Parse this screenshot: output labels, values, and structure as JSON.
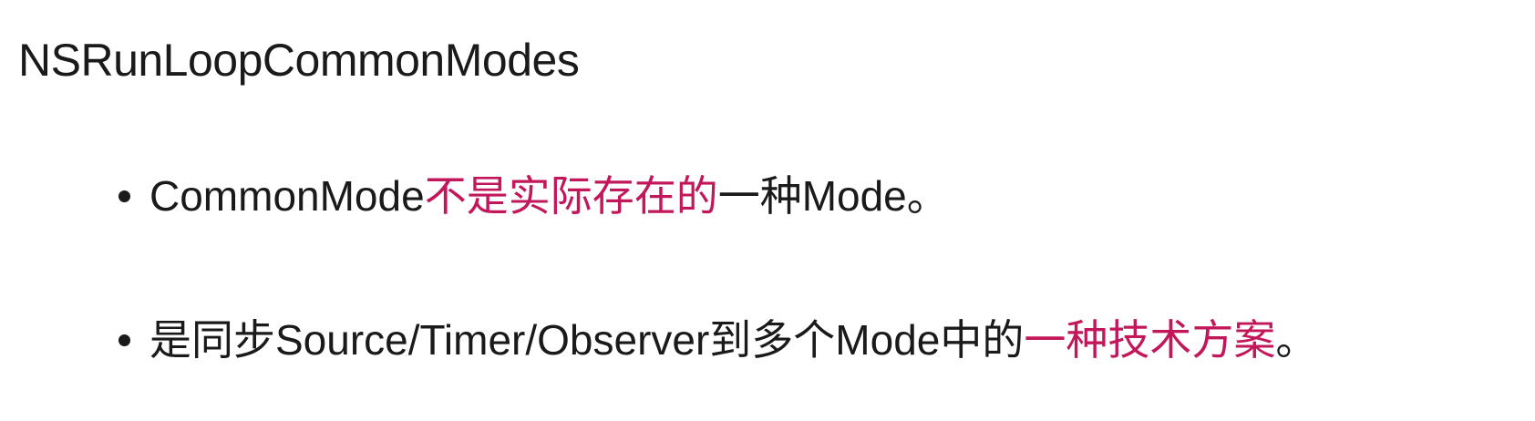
{
  "title": "NSRunLoopCommonModes",
  "accent_color": "#c2185b",
  "bullets": [
    {
      "segments": [
        {
          "text": "CommonMode",
          "highlight": false
        },
        {
          "text": "不是实际存在的",
          "highlight": true
        },
        {
          "text": "一种Mode。",
          "highlight": false
        }
      ]
    },
    {
      "segments": [
        {
          "text": "是同步Source/Timer/Observer到多个Mode中的",
          "highlight": false
        },
        {
          "text": "一种技术方案",
          "highlight": true
        },
        {
          "text": "。",
          "highlight": false
        }
      ]
    }
  ]
}
